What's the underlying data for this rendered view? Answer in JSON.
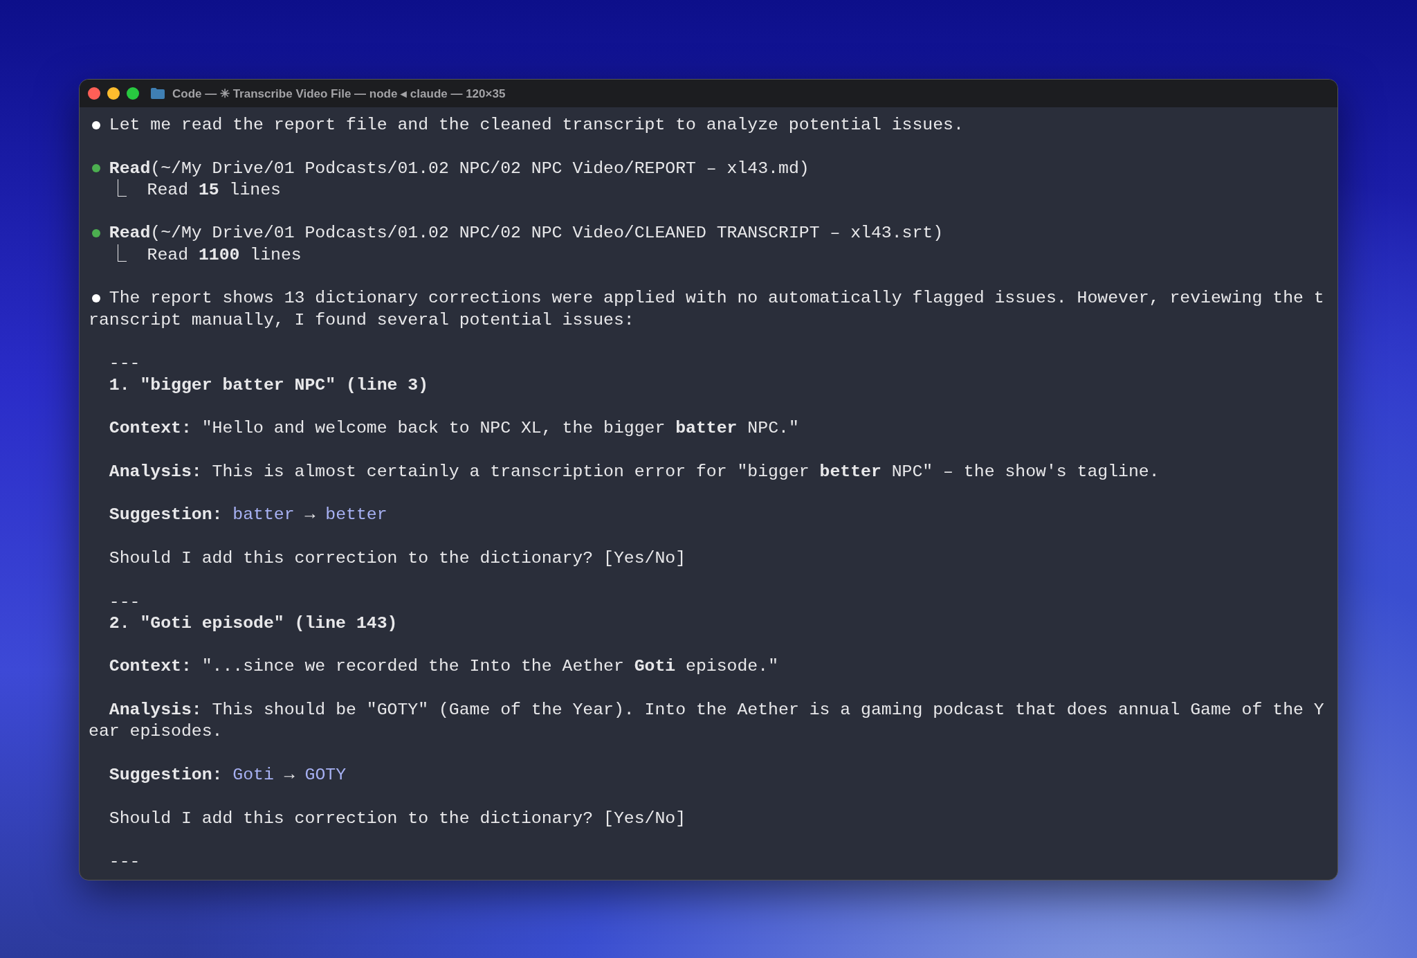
{
  "window": {
    "title": "Code — ✳ Transcribe Video File — node ◂ claude — 120×35"
  },
  "blocks": [
    {
      "kind": "message",
      "color": "#ffffff",
      "lines": [
        "Let me read the report file and the cleaned transcript to analyze potential issues."
      ]
    },
    {
      "kind": "message",
      "color": "#4caf50",
      "lines": [
        "**Read**(~/My Drive/01 Podcasts/01.02 NPC/02 NPC Video/REPORT – xl43.md)"
      ],
      "result": "⎿  Read **15** lines"
    },
    {
      "kind": "message",
      "color": "#4caf50",
      "lines": [
        "**Read**(~/My Drive/01 Podcasts/01.02 NPC/02 NPC Video/CLEANED TRANSCRIPT – xl43.srt)"
      ],
      "result": "⎿  Read **1100** lines"
    },
    {
      "kind": "message",
      "color": "#ffffff",
      "lines": [
        "The report shows 13 dictionary corrections were applied with no automatically flagged issues. However, reviewing the t",
        "ranscript manually, I found several potential issues:"
      ]
    },
    {
      "kind": "heading",
      "rule": "---",
      "text": "1. \"bigger batter NPC\" (line 3)"
    },
    {
      "kind": "text",
      "lines": [
        "**Context:** \"Hello and welcome back to NPC XL, the bigger **batter** NPC.\""
      ]
    },
    {
      "kind": "text",
      "lines": [
        "**Analysis:** This is almost certainly a transcription error for \"bigger **better** NPC\" – the show's tagline."
      ]
    },
    {
      "kind": "suggestion",
      "label": "Suggestion:",
      "from": "batter",
      "arrow": "→",
      "to": "better"
    },
    {
      "kind": "text",
      "lines": [
        "Should I add this correction to the dictionary? [Yes/No]"
      ]
    },
    {
      "kind": "heading",
      "rule": "---",
      "text": "2. \"Goti episode\" (line 143)"
    },
    {
      "kind": "text",
      "lines": [
        "**Context:** \"...since we recorded the Into the Aether **Goti** episode.\""
      ]
    },
    {
      "kind": "text",
      "lines": [
        "**Analysis:** This should be \"GOTY\" (Game of the Year). Into the Aether is a gaming podcast that does annual Game of the Y",
        "ear episodes."
      ]
    },
    {
      "kind": "suggestion",
      "label": "Suggestion:",
      "from": "Goti",
      "arrow": "→",
      "to": "GOTY"
    },
    {
      "kind": "text",
      "lines": [
        "Should I add this correction to the dictionary? [Yes/No]"
      ]
    },
    {
      "kind": "rule",
      "rule": "---"
    }
  ]
}
